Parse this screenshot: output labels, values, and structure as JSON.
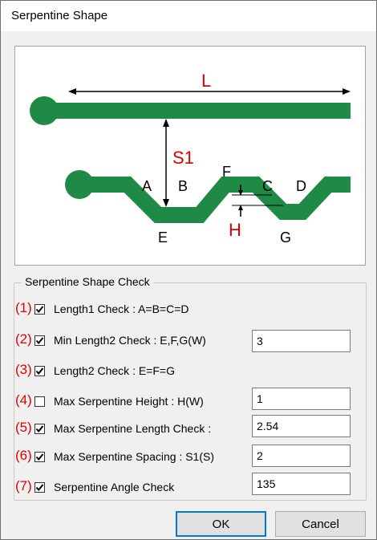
{
  "window": {
    "title": "Serpentine Shape"
  },
  "diagram": {
    "trace_color": "#1e8a46",
    "dimension_color": "#e00000",
    "labels": {
      "L": "L",
      "S1": "S1",
      "H": "H",
      "A": "A",
      "B": "B",
      "C": "C",
      "D": "D",
      "E": "E",
      "F": "F",
      "G": "G"
    }
  },
  "group": {
    "title": "Serpentine Shape Check"
  },
  "checks": [
    {
      "num": "(1)",
      "label": "Length1 Check : A=B=C=D",
      "checked": true,
      "value": null
    },
    {
      "num": "(2)",
      "label": "Min Length2 Check : E,F,G(W)",
      "checked": true,
      "value": "3"
    },
    {
      "num": "(3)",
      "label": "Length2 Check : E=F=G",
      "checked": true,
      "value": null
    },
    {
      "num": "(4)",
      "label": "Max Serpentine Height : H(W)",
      "checked": false,
      "value": "1"
    },
    {
      "num": "(5)",
      "label": "Max Serpentine Length Check :",
      "checked": true,
      "value": "2.54"
    },
    {
      "num": "(6)",
      "label": "Max Serpentine Spacing : S1(S)",
      "checked": true,
      "value": "2"
    },
    {
      "num": "(7)",
      "label": "Serpentine Angle Check",
      "checked": true,
      "value": "135"
    }
  ],
  "buttons": {
    "ok": "OK",
    "cancel": "Cancel"
  }
}
